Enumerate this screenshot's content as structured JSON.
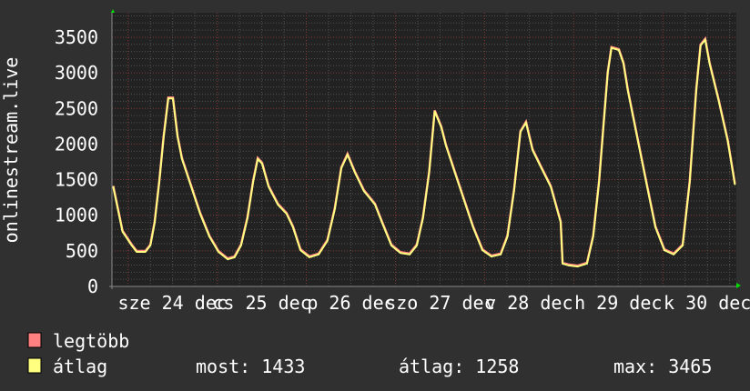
{
  "chart_data": {
    "type": "line",
    "ylabel": "onlinestream.live",
    "xlabel": "",
    "ylim": [
      0,
      3850
    ],
    "xlim": [
      "12-23 19:40",
      "12-30 19:40"
    ],
    "yticks": [
      "0",
      "500",
      "1000",
      "1500",
      "2000",
      "2500",
      "3000",
      "3500"
    ],
    "ytick_values": [
      0,
      500,
      1000,
      1500,
      2000,
      2500,
      3000,
      3500
    ],
    "xticks": [
      {
        "label": "sze 24 dec",
        "at": "12-24 12:00"
      },
      {
        "label": "cs 25 dec",
        "at": "12-25 12:00"
      },
      {
        "label": "p 26 dec",
        "at": "12-26 12:00"
      },
      {
        "label": "szo 27 dec",
        "at": "12-27 12:00"
      },
      {
        "label": "v 28 dec",
        "at": "12-28 12:00"
      },
      {
        "label": "h 29 dec",
        "at": "12-29 12:00"
      },
      {
        "label": "k 30 dec",
        "at": "12-30 12:00"
      }
    ],
    "grid": true,
    "legend_position": "bottom-left",
    "series": [
      {
        "name": "legtöbb",
        "color": "#ff8080"
      },
      {
        "name": "átlag",
        "color": "#ffff80"
      }
    ],
    "points": [
      [
        "12-23 20:00",
        1400
      ],
      [
        "12-23 22:30",
        770
      ],
      [
        "12-24 01:00",
        575
      ],
      [
        "12-24 02:20",
        485
      ],
      [
        "12-24 04:40",
        485
      ],
      [
        "12-24 06:00",
        575
      ],
      [
        "12-24 07:10",
        895
      ],
      [
        "12-24 08:25",
        1470
      ],
      [
        "12-24 09:35",
        2100
      ],
      [
        "12-24 10:50",
        2640
      ],
      [
        "12-24 12:05",
        2640
      ],
      [
        "12-24 13:20",
        2100
      ],
      [
        "12-24 14:30",
        1790
      ],
      [
        "12-24 17:00",
        1400
      ],
      [
        "12-24 19:25",
        1020
      ],
      [
        "12-24 21:55",
        700
      ],
      [
        "12-25 00:20",
        485
      ],
      [
        "12-25 02:50",
        380
      ],
      [
        "12-25 04:40",
        410
      ],
      [
        "12-25 06:25",
        575
      ],
      [
        "12-25 08:10",
        960
      ],
      [
        "12-25 09:40",
        1470
      ],
      [
        "12-25 10:55",
        1790
      ],
      [
        "12-25 12:05",
        1725
      ],
      [
        "12-25 13:50",
        1400
      ],
      [
        "12-25 16:20",
        1150
      ],
      [
        "12-25 18:40",
        1020
      ],
      [
        "12-25 20:25",
        830
      ],
      [
        "12-25 22:25",
        510
      ],
      [
        "12-26 00:50",
        410
      ],
      [
        "12-26 03:20",
        450
      ],
      [
        "12-26 05:40",
        640
      ],
      [
        "12-26 07:40",
        1085
      ],
      [
        "12-26 09:25",
        1660
      ],
      [
        "12-26 11:05",
        1850
      ],
      [
        "12-26 13:05",
        1600
      ],
      [
        "12-26 15:30",
        1340
      ],
      [
        "12-26 18:30",
        1150
      ],
      [
        "12-26 20:25",
        895
      ],
      [
        "12-26 22:55",
        575
      ],
      [
        "12-27 01:20",
        470
      ],
      [
        "12-27 03:50",
        450
      ],
      [
        "12-27 05:45",
        575
      ],
      [
        "12-27 07:25",
        960
      ],
      [
        "12-27 09:05",
        1600
      ],
      [
        "12-27 10:35",
        2460
      ],
      [
        "12-27 12:20",
        2235
      ],
      [
        "12-27 13:35",
        1980
      ],
      [
        "12-27 16:00",
        1600
      ],
      [
        "12-27 18:30",
        1210
      ],
      [
        "12-27 20:55",
        830
      ],
      [
        "12-27 23:25",
        510
      ],
      [
        "12-28 01:50",
        420
      ],
      [
        "12-28 04:20",
        450
      ],
      [
        "12-28 06:10",
        700
      ],
      [
        "12-28 07:55",
        1340
      ],
      [
        "12-28 09:40",
        2170
      ],
      [
        "12-28 11:10",
        2300
      ],
      [
        "12-28 12:55",
        1915
      ],
      [
        "12-28 15:20",
        1660
      ],
      [
        "12-28 17:50",
        1400
      ],
      [
        "12-28 20:30",
        900
      ],
      [
        "12-28 21:00",
        320
      ],
      [
        "12-28 22:40",
        295
      ],
      [
        "12-29 01:05",
        280
      ],
      [
        "12-29 03:35",
        320
      ],
      [
        "12-29 05:15",
        700
      ],
      [
        "12-29 06:50",
        1470
      ],
      [
        "12-29 08:00",
        2235
      ],
      [
        "12-29 09:10",
        3000
      ],
      [
        "12-29 10:10",
        3350
      ],
      [
        "12-29 12:10",
        3320
      ],
      [
        "12-29 13:25",
        3130
      ],
      [
        "12-29 14:35",
        2750
      ],
      [
        "12-29 17:05",
        2100
      ],
      [
        "12-29 19:30",
        1470
      ],
      [
        "12-29 22:00",
        830
      ],
      [
        "12-30 00:25",
        510
      ],
      [
        "12-30 02:55",
        450
      ],
      [
        "12-30 05:20",
        575
      ],
      [
        "12-30 07:15",
        1470
      ],
      [
        "12-30 09:00",
        2750
      ],
      [
        "12-30 10:10",
        3385
      ],
      [
        "12-30 11:25",
        3465
      ],
      [
        "12-30 12:35",
        3130
      ],
      [
        "12-30 15:00",
        2620
      ],
      [
        "12-30 17:30",
        2040
      ],
      [
        "12-30 19:25",
        1433
      ]
    ]
  },
  "legend": {
    "max_label": "legtöbb",
    "avg_label": "átlag",
    "now": "most: 1433",
    "average": "átlag: 1258",
    "maximum": "max: 3465"
  }
}
